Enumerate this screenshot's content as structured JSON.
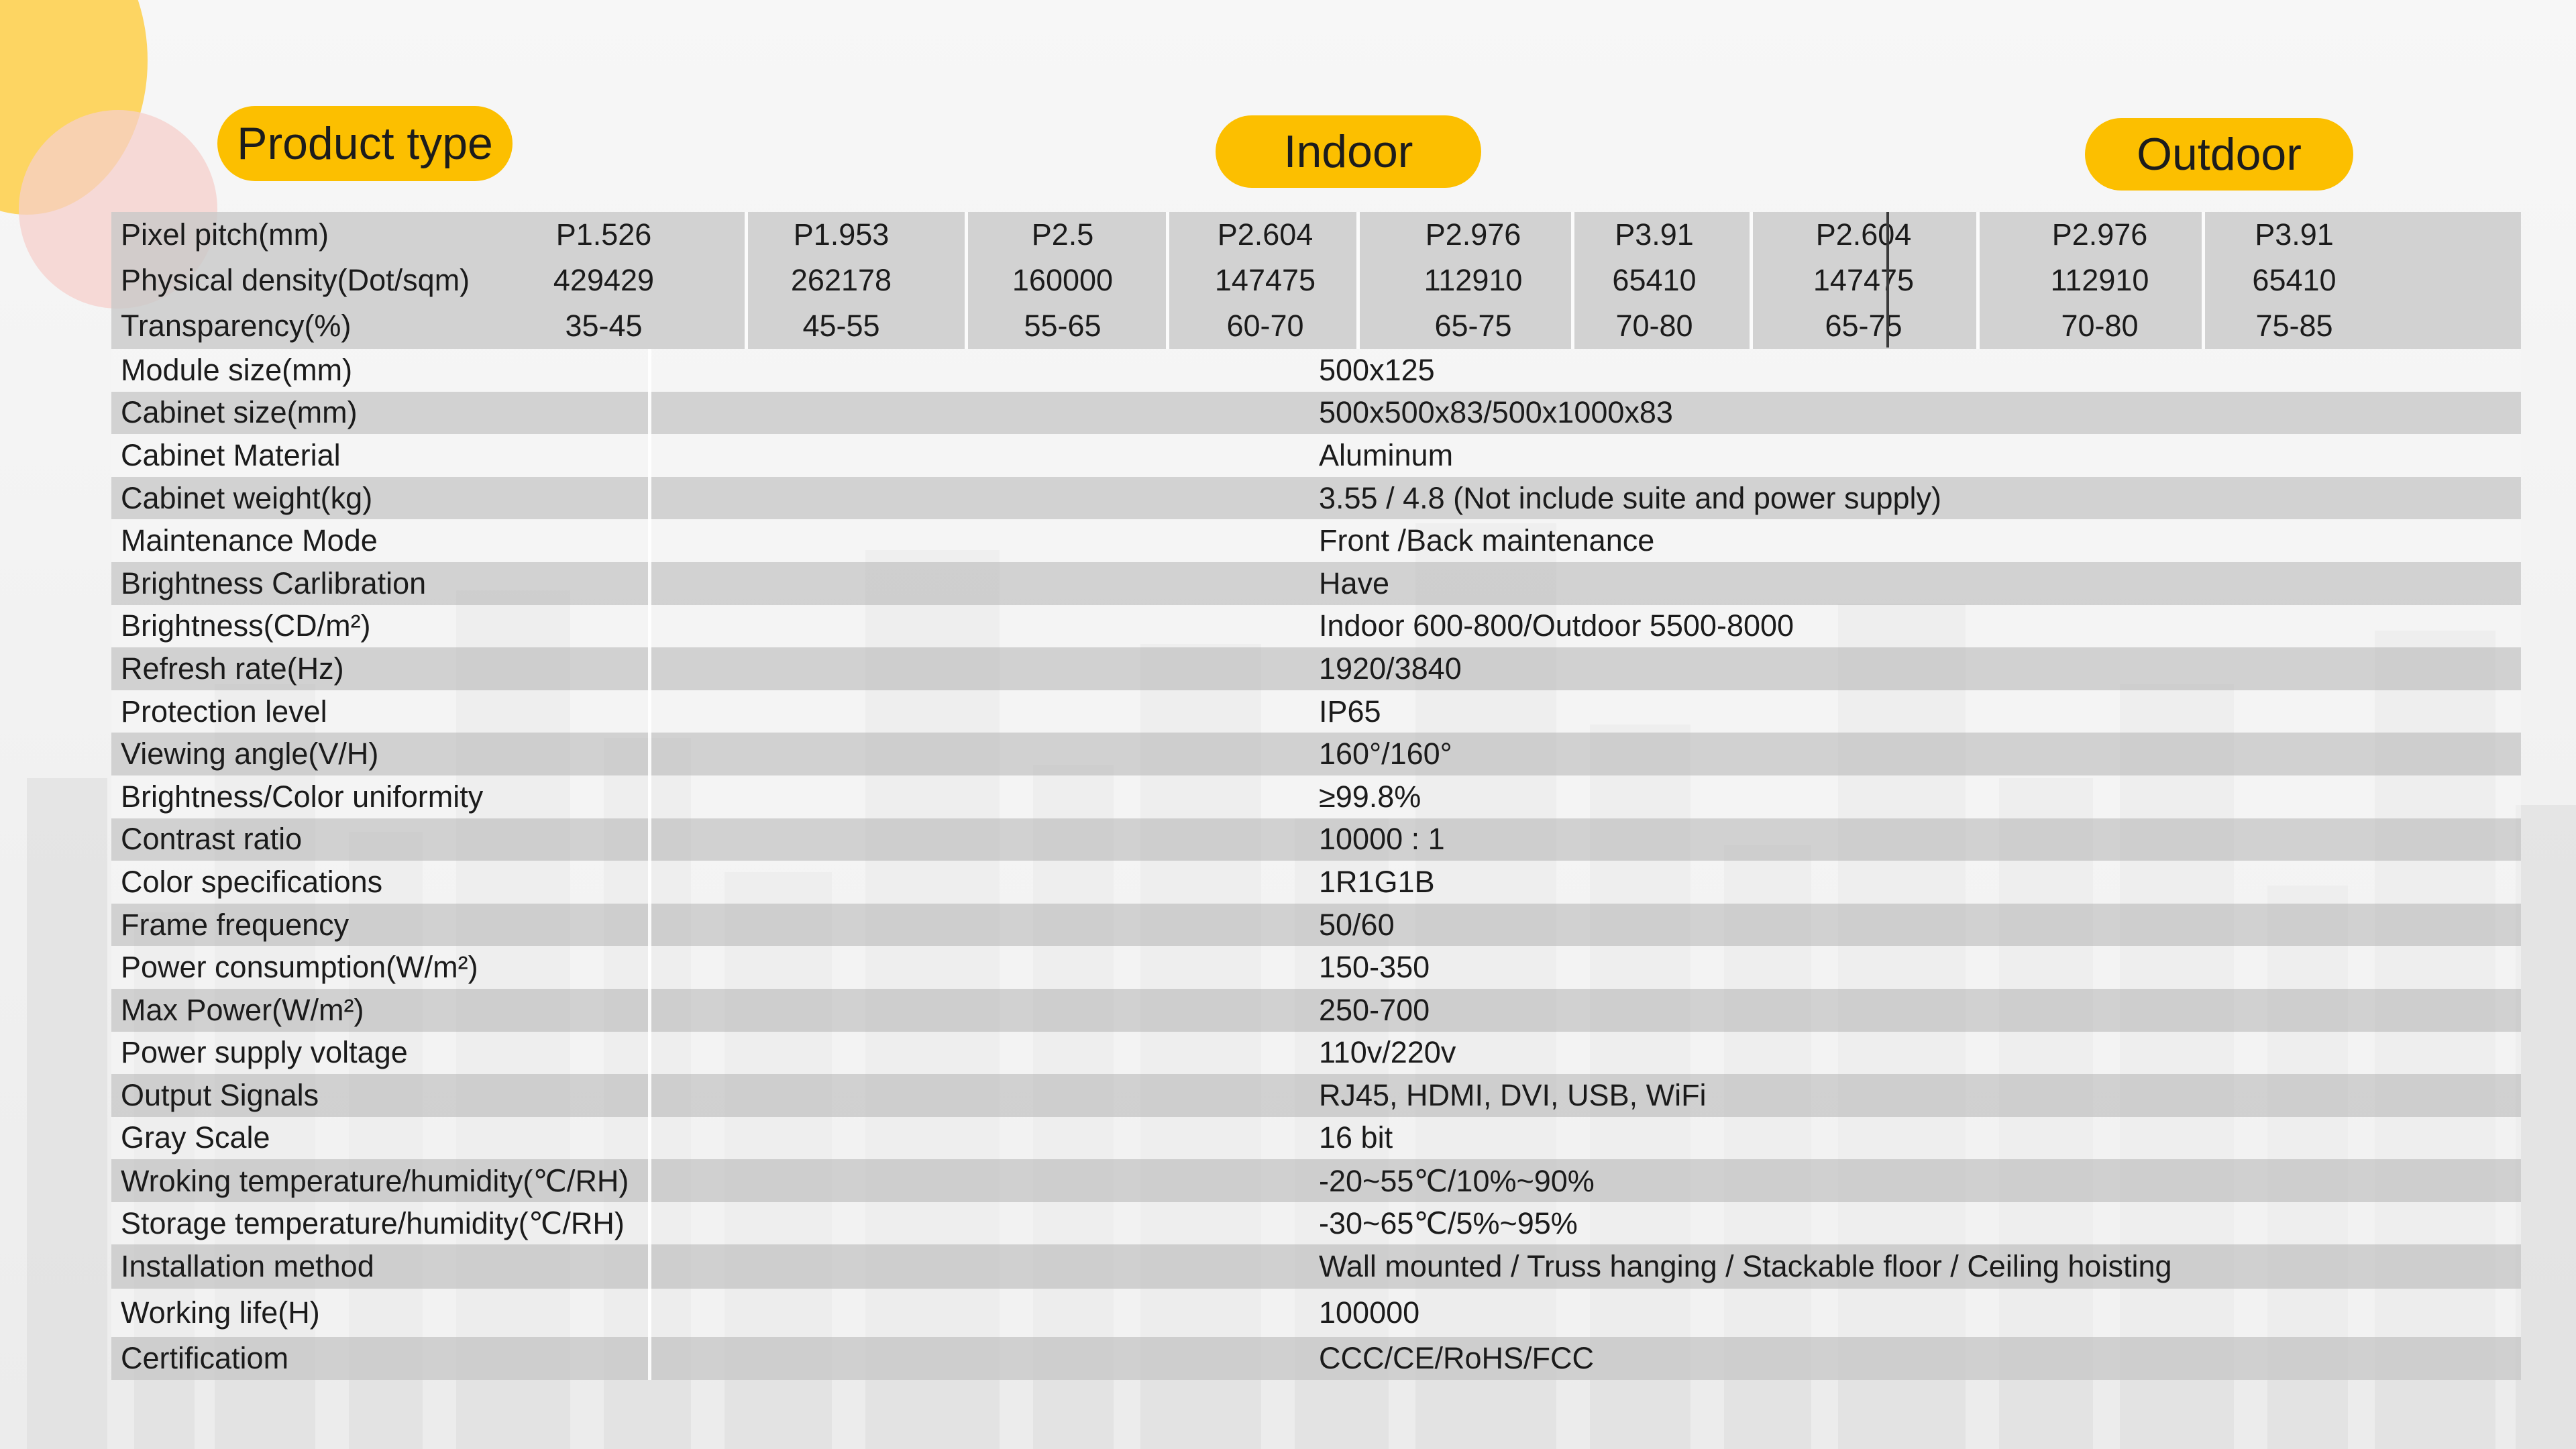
{
  "headers": {
    "product_type": "Product type",
    "indoor": "Indoor",
    "outdoor": "Outdoor"
  },
  "columns": [
    {
      "pitch": "P1.526",
      "density": "429429",
      "transparency": "35-45"
    },
    {
      "pitch": "P1.953",
      "density": "262178",
      "transparency": "45-55"
    },
    {
      "pitch": "P2.5",
      "density": "160000",
      "transparency": "55-65"
    },
    {
      "pitch": "P2.604",
      "density": "147475",
      "transparency": "60-70"
    },
    {
      "pitch": "P2.976",
      "density": "112910",
      "transparency": "65-75"
    },
    {
      "pitch": "P3.91",
      "density": "65410",
      "transparency": "70-80"
    },
    {
      "pitch": "P2.604",
      "density": "147475",
      "transparency": "65-75"
    },
    {
      "pitch": "P2.976",
      "density": "112910",
      "transparency": "70-80"
    },
    {
      "pitch": "P3.91",
      "density": "65410",
      "transparency": "75-85"
    }
  ],
  "multi_rows": {
    "pixel_pitch": "Pixel pitch(mm)",
    "density": "Physical density(Dot/sqm)",
    "transparency": "Transparency(%)"
  },
  "specs": [
    {
      "label": "Module size(mm)",
      "value": "500x125"
    },
    {
      "label": "Cabinet size(mm)",
      "value": "500x500x83/500x1000x83"
    },
    {
      "label": "Cabinet Material",
      "value": "Aluminum"
    },
    {
      "label": "Cabinet weight(kg)",
      "value": "3.55 / 4.8  (Not include suite and power supply)"
    },
    {
      "label": "Maintenance Mode",
      "value": "Front /Back maintenance"
    },
    {
      "label": "Brightness Carlibration",
      "value": "Have"
    },
    {
      "label": "Brightness(CD/m²)",
      "value": "Indoor 600-800/Outdoor 5500-8000"
    },
    {
      "label": "Refresh rate(Hz)",
      "value": "1920/3840"
    },
    {
      "label": "Protection level",
      "value": "IP65"
    },
    {
      "label": "Viewing angle(V/H)",
      "value": "160°/160°"
    },
    {
      "label": "Brightness/Color uniformity",
      "value": "≥99.8%"
    },
    {
      "label": "Contrast ratio",
      "value": "10000 : 1"
    },
    {
      "label": "Color specifications",
      "value": "1R1G1B"
    },
    {
      "label": "Frame frequency",
      "value": "50/60"
    },
    {
      "label": "Power consumption(W/m²)",
      "value": "150-350"
    },
    {
      "label": "Max Power(W/m²)",
      "value": "250-700"
    },
    {
      "label": "Power supply voltage",
      "value": "110v/220v"
    },
    {
      "label": "Output Signals",
      "value": "RJ45, HDMI, DVI, USB, WiFi"
    },
    {
      "label": "Gray Scale",
      "value": "16 bit"
    },
    {
      "label": "Wroking temperature/humidity(℃/RH)",
      "value": "-20~55℃/10%~90%"
    },
    {
      "label": "Storage  temperature/humidity(℃/RH)",
      "value": "-30~65℃/5%~95%"
    },
    {
      "label": "Installation method",
      "value": "Wall mounted / Truss hanging / Stackable floor / Ceiling hoisting"
    },
    {
      "label": "Working life(H)",
      "value": "100000"
    },
    {
      "label": "Certificatiom",
      "value": "CCC/CE/RoHS/FCC"
    }
  ],
  "colors": {
    "accent": "#fcbf00",
    "circle_yellow": "#fdd35a",
    "circle_pink": "#f6cfcb",
    "row_shade": "#c8c8c8"
  }
}
